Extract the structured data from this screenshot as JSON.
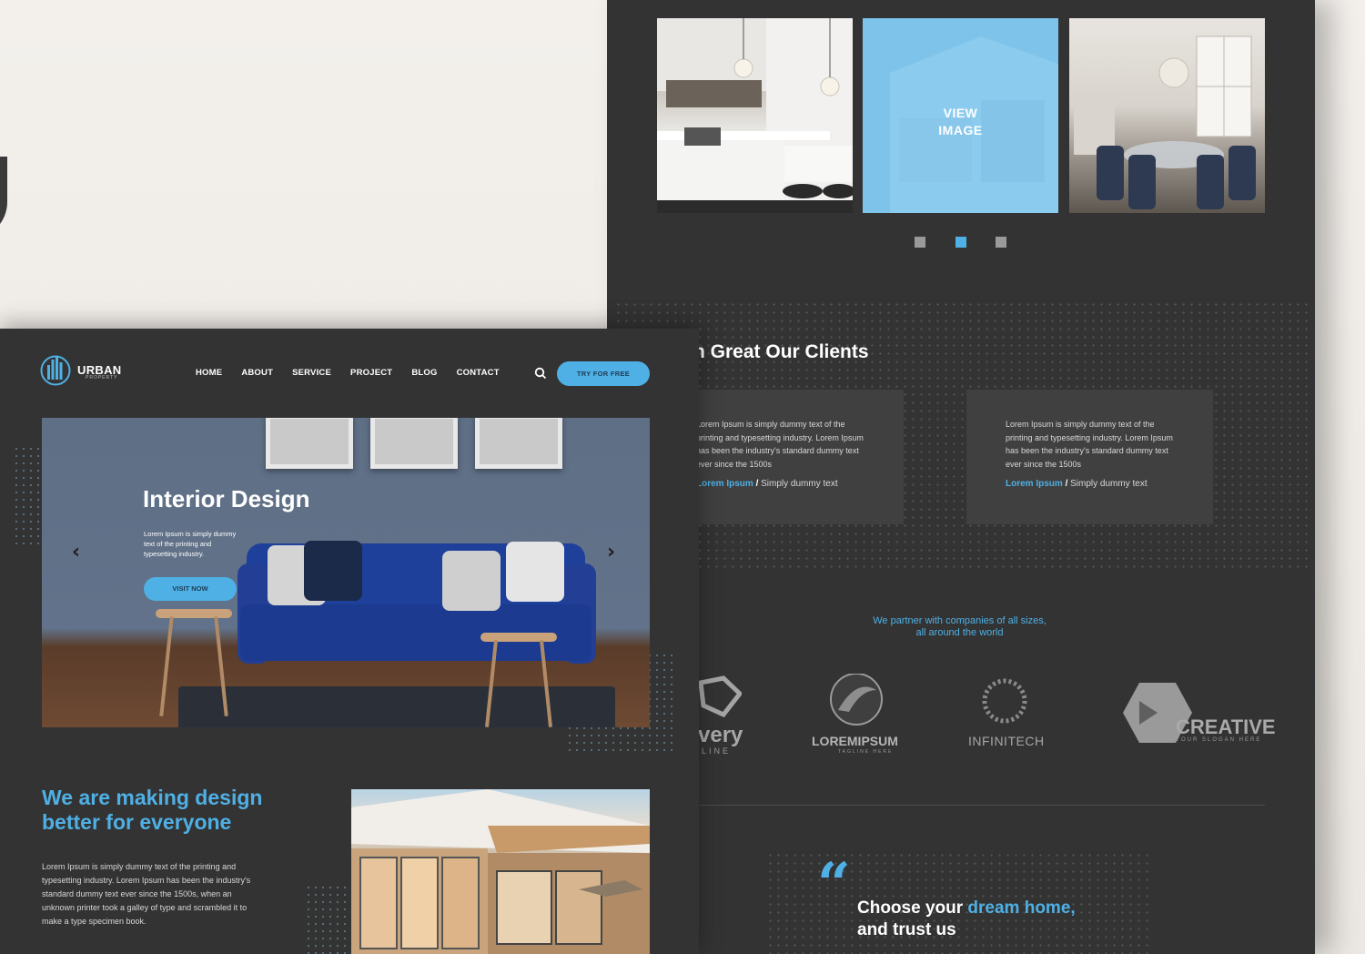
{
  "back_page": {
    "gallery": {
      "tiles": [
        {
          "name": "kitchen"
        },
        {
          "name": "view-image",
          "label": "VIEW\nIMAGE"
        },
        {
          "name": "dining"
        }
      ],
      "pager_active": 2
    },
    "clients": {
      "title": "n Great Our Clients",
      "cards": [
        {
          "text": "Lorem Ipsum is simply dummy text of the printing and typesetting industry. Lorem Ipsum has been the industry's standard dummy text ever since the 1500s",
          "author": "Lorem Ipsum",
          "separator": "/",
          "role": "Simply dummy text"
        },
        {
          "text": "Lorem Ipsum is simply dummy text of the printing and typesetting industry. Lorem Ipsum has been the industry's standard dummy text ever since the 1500s",
          "author": "Lorem Ipsum",
          "separator": "/",
          "role": "Simply dummy text"
        }
      ]
    },
    "partners": {
      "text": "We partner with companies of all sizes,\nall around the world",
      "logos": [
        {
          "name": "very",
          "sub": "LINE"
        },
        {
          "name": "LOREMIPSUM",
          "sub": "TAGLINE HERE"
        },
        {
          "name": "INFINITECH"
        },
        {
          "name": "CREATIVE",
          "sub": "YOUR SLOGAN HERE"
        }
      ]
    },
    "quote": {
      "mark": "“",
      "line_pre": "Choose your",
      "line_accent": "dream home,",
      "line_post": "and trust us"
    }
  },
  "front_page": {
    "brand": {
      "name": "URBAN",
      "sub": "PROPERTY"
    },
    "nav": [
      "HOME",
      "ABOUT",
      "SERVICE",
      "PROJECT",
      "BLOG",
      "CONTACT"
    ],
    "cta": "TRY FOR FREE",
    "hero": {
      "title": "Interior Design",
      "text": "Lorem Ipsum is simply dummy text of the printing and typesetting industry.",
      "button": "VISIT NOW",
      "prev": "‹",
      "next": "›"
    },
    "about": {
      "heading": "We are making design better for everyone",
      "text": "Lorem Ipsum is simply dummy text of the printing and typesetting industry. Lorem Ipsum has been the industry's standard dummy text ever since the 1500s, when an unknown printer took a galley of type and scrambled it to make a type specimen book."
    }
  },
  "colors": {
    "page_bg": "#333333",
    "accent": "#4fb0e5",
    "backdrop": "#f3f0ec",
    "card": "#404040"
  }
}
